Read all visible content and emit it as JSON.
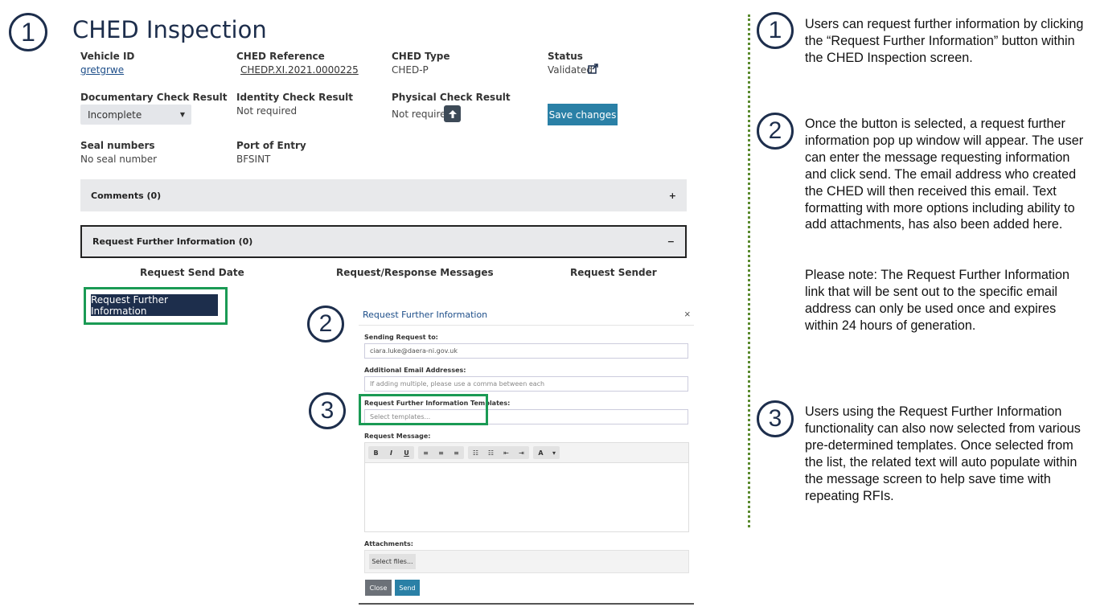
{
  "markers": [
    "1",
    "2",
    "3"
  ],
  "page": {
    "title": "CHED Inspection"
  },
  "fields": {
    "vehicle_id_label": "Vehicle ID",
    "vehicle_id": "gretgrwe",
    "ched_ref_label": "CHED Reference",
    "ched_ref": "CHEDP.XI.2021.0000225",
    "ched_type_label": "CHED Type",
    "ched_type": "CHED-P",
    "status_label": "Status",
    "status": "Validated",
    "doc_check_label": "Documentary Check Result",
    "doc_check_value": "Incomplete",
    "identity_label": "Identity Check Result",
    "identity_value": "Not required",
    "physical_label": "Physical Check Result",
    "physical_value": "Not required",
    "seal_label": "Seal numbers",
    "seal_value": "No seal number",
    "port_label": "Port of Entry",
    "port_value": "BFSINT"
  },
  "buttons": {
    "save": "Save changes",
    "rfi": "Request Further Information"
  },
  "panels": {
    "comments": "Comments (0)",
    "comments_sign": "+",
    "rfi": "Request Further Information (0)",
    "rfi_sign": "−"
  },
  "table": {
    "headers": [
      "Request Send Date",
      "Request/Response Messages",
      "Request Sender"
    ]
  },
  "modal": {
    "title": "Request Further Information",
    "close_icon": "×",
    "sending_label": "Sending Request to:",
    "sending_value": "ciara.luke@daera-ni.gov.uk",
    "additional_label": "Additional Email Addresses:",
    "additional_placeholder": "If adding multiple, please use a comma between each",
    "templates_label": "Request Further Information Templates:",
    "templates_placeholder": "Select templates...",
    "message_label": "Request Message:",
    "toolbar": {
      "bold": "B",
      "italic": "I",
      "underline": "U",
      "align_left": "≡",
      "align_center": "≡",
      "align_right": "≡",
      "bullets": "☷",
      "numbers": "☷",
      "outdent": "⇤",
      "indent": "⇥",
      "color": "A",
      "color_caret": "▾"
    },
    "attachments_label": "Attachments:",
    "select_files": "Select files...",
    "close_button": "Close",
    "send_button": "Send"
  },
  "notes": [
    "Users can request further information by clicking the “Request Further Information” button within the CHED Inspection screen.",
    "Once the button is selected, a request further information pop up window will appear. The user can enter the message requesting information and click send. The email address who created the CHED will then received this email. Text formatting with more options including ability to add attachments, has also been added here.",
    "Please note: The Request Further Information link that will be sent out to the specific email address can only be used once and expires within 24 hours of generation.",
    "Users using the Request Further Information functionality can also now selected from various pre-determined templates. Once selected from the list, the related text will auto populate within the message screen to help save time with repeating RFIs."
  ],
  "colors": {
    "navy": "#1d2e4c",
    "teal": "#2a80a6",
    "green_highlight": "#1a9a54",
    "divider": "#5a8a2e"
  },
  "icons": {
    "external_link": "external-link-icon",
    "upload": "arrow-up-icon"
  }
}
